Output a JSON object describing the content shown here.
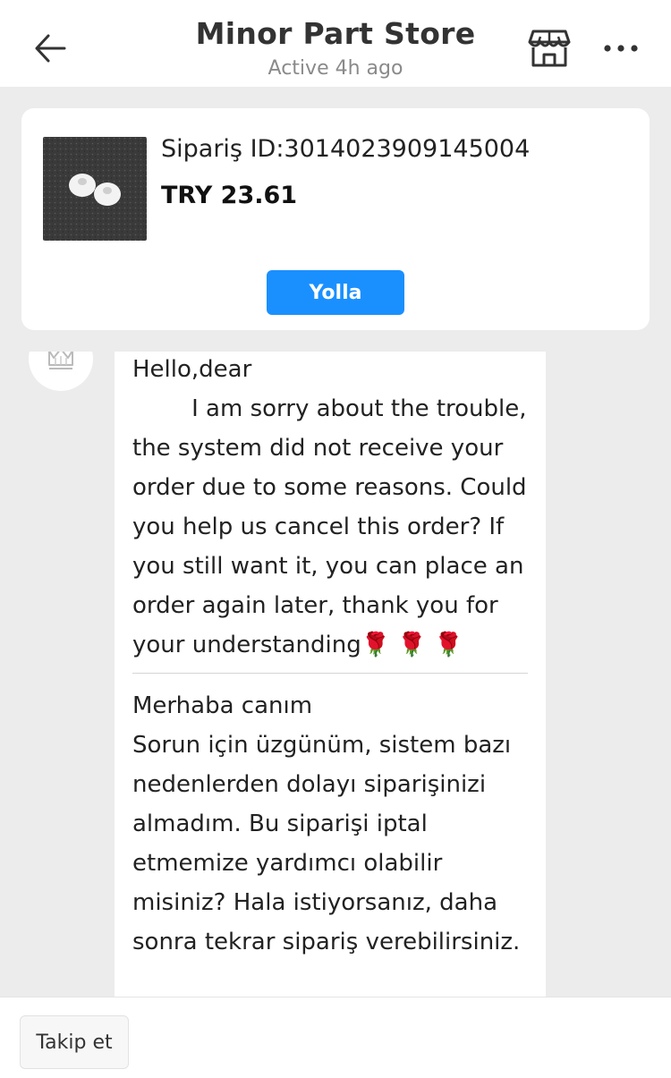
{
  "header": {
    "title": "Minor Part Store",
    "status": "Active 4h ago",
    "icons": {
      "back": "arrow-left-icon",
      "store": "store-icon",
      "more": "more-horizontal-icon"
    }
  },
  "order": {
    "order_id": "Sipariş ID:3014023909145004",
    "price": "TRY 23.61",
    "send_button": "Yolla",
    "accent_color": "#1a90ff"
  },
  "chat": {
    "avatar_icon": "crown-icon",
    "message_en": "Hello,dear\n        I am sorry about the trouble, the system did not receive your order due to some reasons. Could you help us cancel this order? If you still want it, you can place an order again later, thank you for your understanding🌹 🌹 🌹",
    "message_tr": "Merhaba canım\nSorun için üzgünüm, sistem bazı nedenlerden dolayı siparişinizi almadım. Bu siparişi iptal etmemize yardımcı olabilir misiniz? Hala istiyorsanız, daha sonra tekrar sipariş verebilirsiniz."
  },
  "footer": {
    "follow_button": "Takip et"
  }
}
